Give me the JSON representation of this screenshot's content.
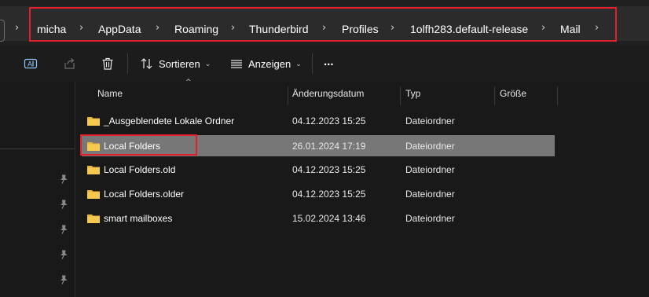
{
  "breadcrumb": {
    "items": [
      "micha",
      "AppData",
      "Roaming",
      "Thunderbird",
      "Profiles",
      "1olfh283.default-release",
      "Mail"
    ]
  },
  "toolbar": {
    "sort_label": "Sortieren",
    "view_label": "Anzeigen",
    "more_label": "..."
  },
  "columns": {
    "name": "Name",
    "date": "Änderungsdatum",
    "type": "Typ",
    "size": "Größe"
  },
  "files": [
    {
      "name": "_Ausgeblendete Lokale Ordner",
      "date": "04.12.2023 15:25",
      "type": "Dateiordner",
      "selected": false
    },
    {
      "name": "Local Folders",
      "date": "26.01.2024 17:19",
      "type": "Dateiordner",
      "selected": true
    },
    {
      "name": "Local Folders.old",
      "date": "04.12.2023 15:25",
      "type": "Dateiordner",
      "selected": false
    },
    {
      "name": "Local Folders.older",
      "date": "04.12.2023 15:25",
      "type": "Dateiordner",
      "selected": false
    },
    {
      "name": "smart mailboxes",
      "date": "15.02.2024 13:46",
      "type": "Dateiordner",
      "selected": false
    }
  ],
  "colors": {
    "highlight": "#e0202a",
    "folder": "#f0c24b",
    "selection": "#777777",
    "accent": "#4aa3f0"
  },
  "icons": {
    "rename": "rename-icon",
    "share": "share-icon",
    "delete": "trash-icon",
    "sort": "sort-icon",
    "view": "view-icon",
    "more": "more-icon",
    "pin": "pin-icon",
    "folder": "folder-icon"
  }
}
